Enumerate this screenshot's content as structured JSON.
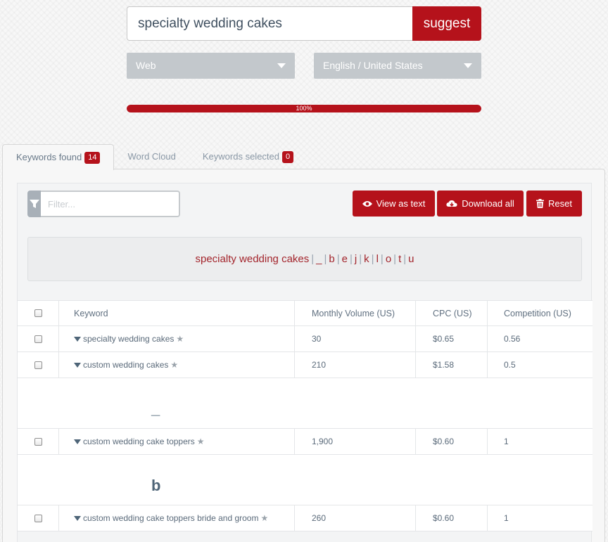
{
  "search": {
    "query": "specialty wedding cakes",
    "button_label": "suggest"
  },
  "selects": {
    "source": "Web",
    "language": "English / United States"
  },
  "progress": {
    "percent": 100,
    "label": "100%"
  },
  "tabs": [
    {
      "label": "Keywords found",
      "badge": "14"
    },
    {
      "label": "Word Cloud"
    },
    {
      "label": "Keywords selected",
      "badge": "0"
    }
  ],
  "filter": {
    "placeholder": "Filter..."
  },
  "actions": {
    "view_text": "View as text",
    "download_all": "Download all",
    "reset": "Reset"
  },
  "letterbar": {
    "phrase": "specialty wedding cakes",
    "letters": [
      "_",
      "b",
      "e",
      "j",
      "k",
      "l",
      "o",
      "t",
      "u"
    ]
  },
  "table": {
    "headers": {
      "keyword": "Keyword",
      "volume": "Monthly Volume (US)",
      "cpc": "CPC (US)",
      "competition": "Competition (US)"
    },
    "rows": [
      {
        "keyword": "specialty wedding cakes",
        "volume": "30",
        "cpc": "$0.65",
        "competition": "0.56"
      },
      {
        "keyword": "custom wedding cakes",
        "volume": "210",
        "cpc": "$1.58",
        "competition": "0.5"
      },
      {
        "group": "_"
      },
      {
        "keyword": "custom wedding cake toppers",
        "volume": "1,900",
        "cpc": "$0.60",
        "competition": "1"
      },
      {
        "group": "b"
      },
      {
        "keyword": "custom wedding cake toppers bride and groom",
        "volume": "260",
        "cpc": "$0.60",
        "competition": "1"
      }
    ]
  },
  "colors": {
    "accent": "#b5121b",
    "select_bg": "#c3c8cc",
    "text_dark": "#4e6578"
  }
}
